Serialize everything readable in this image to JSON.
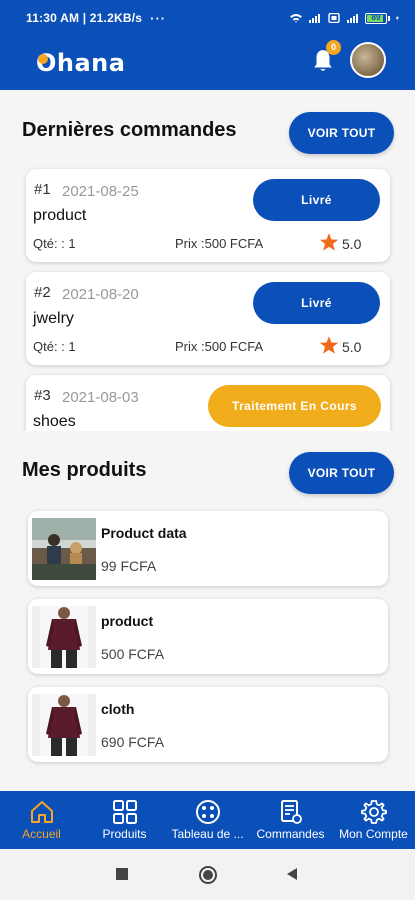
{
  "status_bar": {
    "time": "11:30 AM | 21.2KB/s",
    "dots": "···",
    "battery": "89"
  },
  "app": {
    "logo": "Ohana",
    "notification_count": "0"
  },
  "orders_section": {
    "title": "Dernières commandes",
    "voir_tout": "VOIR TOUT",
    "orders": [
      {
        "num": "#1",
        "date": "2021-08-25",
        "name": "product",
        "qty": "Qté: : 1",
        "price": "Prix :500 FCFA",
        "rating": "5.0",
        "status": "Livré"
      },
      {
        "num": "#2",
        "date": "2021-08-20",
        "name": "jwelry",
        "qty": "Qté: : 1",
        "price": "Prix :500 FCFA",
        "rating": "5.0",
        "status": "Livré"
      },
      {
        "num": "#3",
        "date": "2021-08-03",
        "name": "shoes",
        "status": "Traitement En Cours"
      }
    ]
  },
  "products_section": {
    "title": "Mes produits",
    "voir_tout": "VOIR TOUT",
    "products": [
      {
        "name": "Product data",
        "price": "99 FCFA"
      },
      {
        "name": "product",
        "price": "500 FCFA"
      },
      {
        "name": "cloth",
        "price": "690 FCFA"
      }
    ]
  },
  "bottom_nav": {
    "items": [
      {
        "label": "Accueil",
        "icon": "home-icon"
      },
      {
        "label": "Produits",
        "icon": "grid-icon"
      },
      {
        "label": "Tableau de ...",
        "icon": "dashboard-icon"
      },
      {
        "label": "Commandes",
        "icon": "orders-icon"
      },
      {
        "label": "Mon Compte",
        "icon": "gear-icon"
      }
    ]
  },
  "colors": {
    "primary": "#0b4fb8",
    "accent": "#f5a623",
    "status_orange": "#f0ac1b"
  }
}
